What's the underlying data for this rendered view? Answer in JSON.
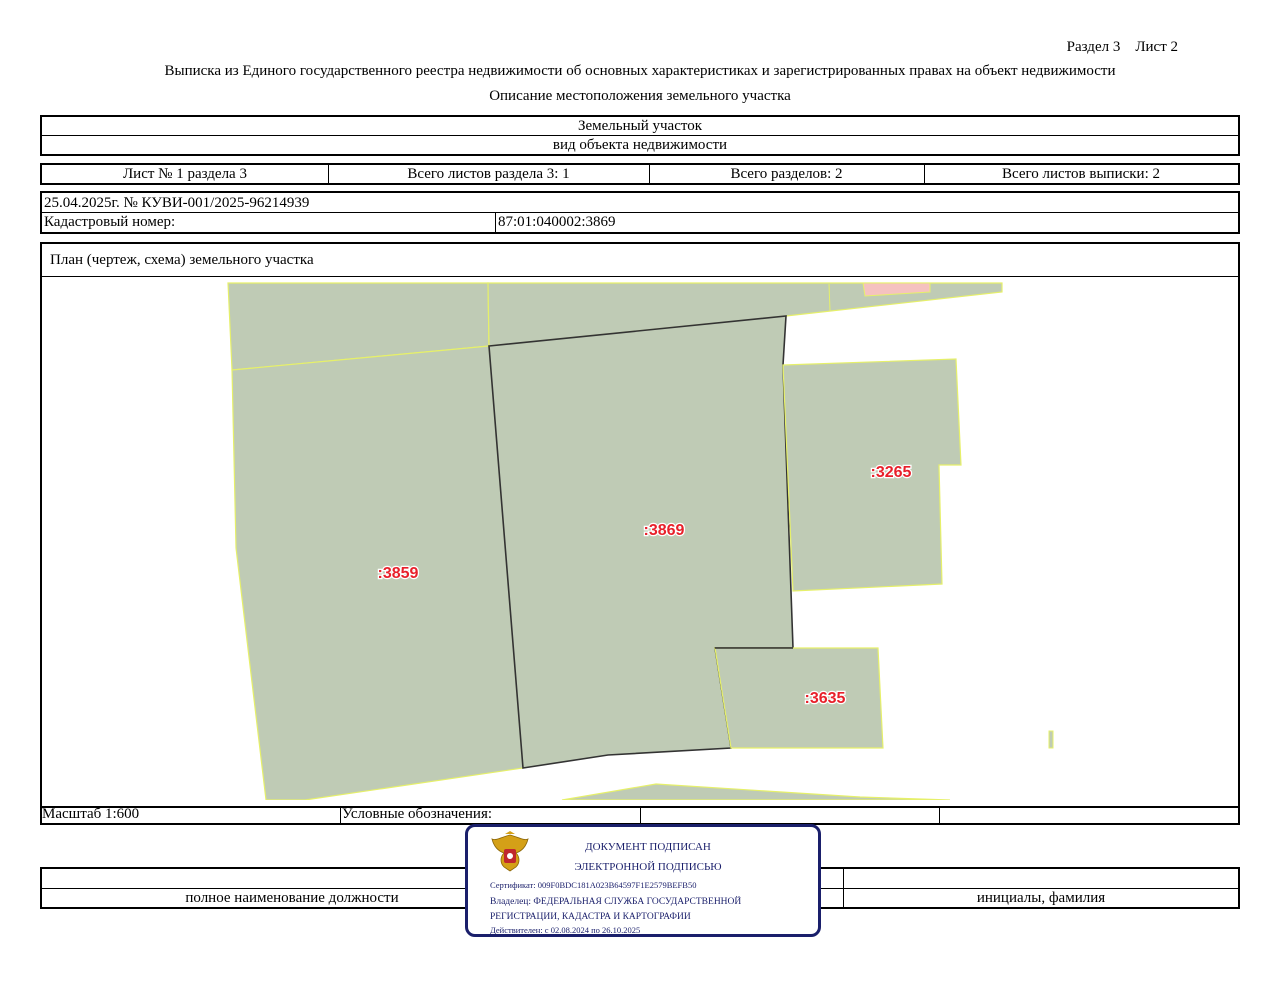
{
  "header": {
    "section_sheet": "Раздел 3    Лист 2",
    "title": "Выписка из Единого государственного реестра недвижимости об основных характеристиках и зарегистрированных правах на объект недвижимости",
    "subtitle": "Описание местоположения земельного участка"
  },
  "object": {
    "name": "Земельный участок",
    "kind_caption": "вид объекта недвижимости"
  },
  "sheets": {
    "sheet_of_section": "Лист № 1 раздела 3",
    "total_sheets_section": "Всего листов раздела 3: 1",
    "total_sections": "Всего разделов: 2",
    "total_sheets_extract": "Всего листов выписки: 2"
  },
  "record": {
    "date_number": "25.04.2025г. № КУВИ-001/2025-96214939",
    "cadastral_label": "Кадастровый номер:",
    "cadastral_value": "87:01:040002:3869"
  },
  "plan": {
    "title": "План (чертеж, схема) земельного участка",
    "parcels": [
      ":3859",
      ":3869",
      ":3265",
      ":3635"
    ],
    "colors": {
      "parcel_fill": "#bfcbb5",
      "parcel_border": "#e6f06a",
      "parcel_edge": "#333333",
      "label": "#e8202a",
      "pink": "#f5c2c0"
    }
  },
  "footer": {
    "scale": "Масштаб 1:600",
    "legend": "Условные обозначения:",
    "position_caption": "полное наименование должности",
    "name_caption": "инициалы, фамилия"
  },
  "stamp": {
    "line1": "ДОКУМЕНТ ПОДПИСАН",
    "line2": "ЭЛЕКТРОННОЙ ПОДПИСЬЮ",
    "certificate": "Сертификат: 009F0BDC181A023B64597F1E2579BEFB50",
    "owner": "Владелец: ФЕДЕРАЛЬНАЯ СЛУЖБА ГОСУДАРСТВЕННОЙ",
    "owner2": "РЕГИСТРАЦИИ, КАДАСТРА И КАРТОГРАФИИ",
    "valid": "Действителен: с 02.08.2024 по 26.10.2025",
    "emblem": "coat-of-arms-icon",
    "border_color": "#1a1f6b"
  }
}
